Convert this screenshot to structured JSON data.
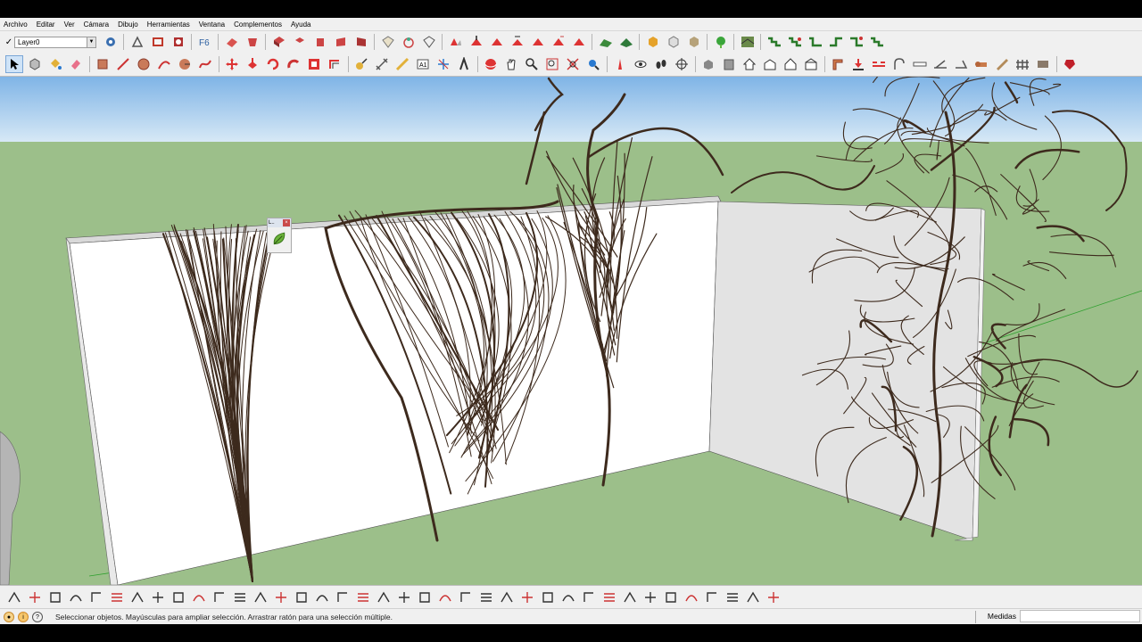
{
  "menu": [
    "Archivo",
    "Editar",
    "Ver",
    "Cámara",
    "Dibujo",
    "Herramientas",
    "Ventana",
    "Complementos",
    "Ayuda"
  ],
  "layer": {
    "checked": "✓",
    "value": "Layer0"
  },
  "float_panel": {
    "title": "L.."
  },
  "status": {
    "message": "Seleccionar objetos. Mayúsculas para ampliar selección. Arrastrar ratón para una selección múltiple."
  },
  "measurements": {
    "label": "Medidas",
    "value": ""
  },
  "colors": {
    "sky_top": "#7fb4e6",
    "sky_bottom": "#d8e9f6",
    "ground": "#9cbf8a",
    "wall_front": "#ffffff",
    "wall_side": "#e3e3e3",
    "vine": "#3d2a1d",
    "accent_red": "#d02f2f"
  }
}
